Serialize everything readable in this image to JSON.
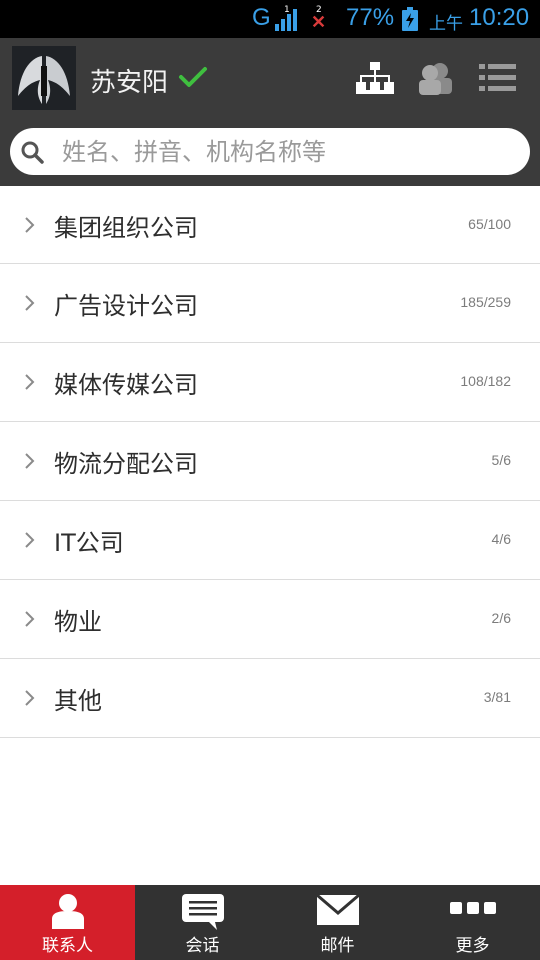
{
  "status_bar": {
    "network": "G",
    "sim1": "1",
    "sim2": "2",
    "battery": "77%",
    "ampm": "上午",
    "time": "10:20"
  },
  "header": {
    "username": "苏安阳",
    "icons": [
      "org-chart-icon",
      "contacts-group-icon",
      "list-menu-icon"
    ]
  },
  "search": {
    "placeholder": "姓名、拼音、机构名称等"
  },
  "groups": [
    {
      "name": "集团组织公司",
      "count": "65/100"
    },
    {
      "name": "广告设计公司",
      "count": "185/259"
    },
    {
      "name": "媒体传媒公司",
      "count": "108/182"
    },
    {
      "name": "物流分配公司",
      "count": "5/6"
    },
    {
      "name": "IT公司",
      "count": "4/6"
    },
    {
      "name": "物业",
      "count": "2/6"
    },
    {
      "name": "其他",
      "count": "3/81"
    }
  ],
  "nav": {
    "tabs": [
      {
        "label": "联系人",
        "icon": "person-icon",
        "active": true
      },
      {
        "label": "会话",
        "icon": "chat-bubble-icon",
        "active": false
      },
      {
        "label": "邮件",
        "icon": "mail-icon",
        "active": false
      },
      {
        "label": "更多",
        "icon": "more-dots-icon",
        "active": false
      }
    ]
  },
  "colors": {
    "accent": "#d41f2a",
    "header_bg": "#3b3b3b",
    "status_text": "#3aa0e8",
    "verified": "#3fbf3f"
  }
}
